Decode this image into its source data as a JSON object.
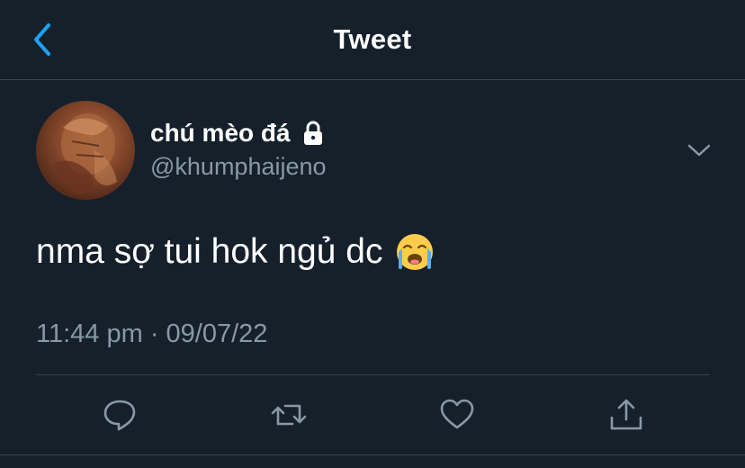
{
  "header": {
    "title": "Tweet",
    "back_icon": "chevron-left-icon"
  },
  "colors": {
    "background": "#15202b",
    "accent": "#1da1f2",
    "secondary_text": "#8899a6",
    "divider": "#38444d"
  },
  "tweet": {
    "author": {
      "display_name": "chú mèo đá",
      "handle": "@khumphaijeno",
      "protected_icon": "lock-icon",
      "avatar_icon": "avatar"
    },
    "text": "nma sợ tui hok ngủ dc",
    "emoji": "loudly-crying-face-emoji",
    "timestamp": "11:44 pm · 09/07/22",
    "more_icon": "chevron-down-icon"
  },
  "actions": [
    {
      "icon": "reply-icon"
    },
    {
      "icon": "retweet-icon"
    },
    {
      "icon": "like-icon"
    },
    {
      "icon": "share-icon"
    }
  ]
}
